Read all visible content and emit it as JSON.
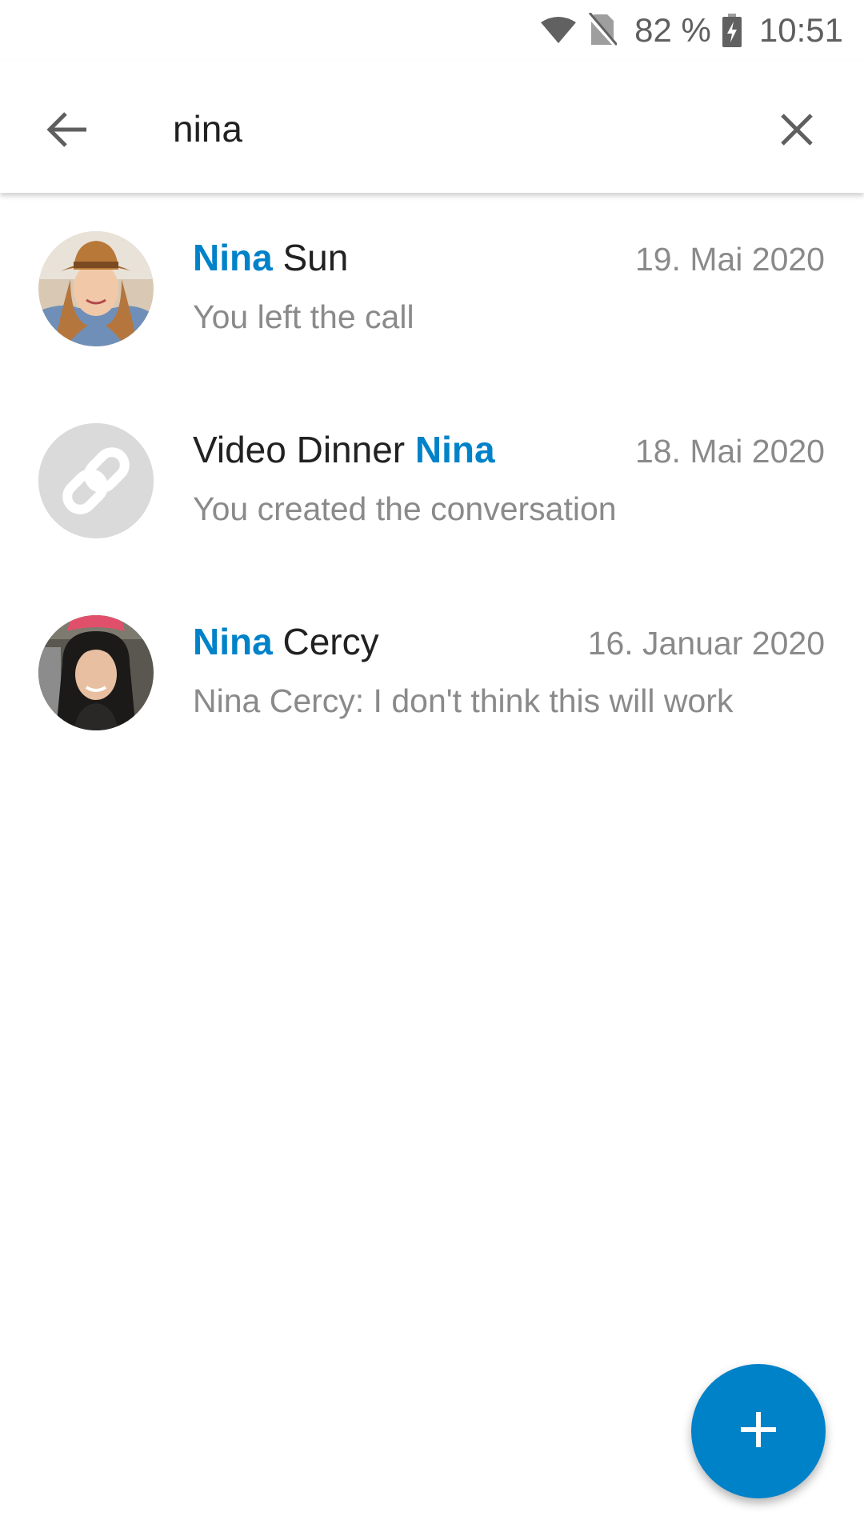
{
  "status_bar": {
    "icons": [
      "wifi-icon",
      "no-sim-icon",
      "battery-charging-icon"
    ],
    "battery": "82 %",
    "time": "10:51"
  },
  "search": {
    "query": "nina",
    "back_icon": "arrow-left-icon",
    "clear_icon": "close-icon"
  },
  "results": [
    {
      "title_highlight": "Nina",
      "title_rest": " Sun",
      "date": "19. Mai 2020",
      "preview": "You left the call",
      "avatar": "photo-avatar-nina-sun"
    },
    {
      "title_rest": "Video Dinner ",
      "title_highlight": "Nina",
      "date": "18. Mai 2020",
      "preview": "You created the conversation",
      "avatar": "link-icon"
    },
    {
      "title_highlight": "Nina",
      "title_rest": " Cercy",
      "date": "16. Januar 2020",
      "preview": "Nina Cercy: I don't think this will work",
      "avatar": "photo-avatar-nina-cercy"
    }
  ],
  "fab": {
    "icon": "plus-icon"
  },
  "colors": {
    "accent": "#0082c9",
    "secondary_text": "#8a8a8a",
    "primary_text": "#212121"
  }
}
